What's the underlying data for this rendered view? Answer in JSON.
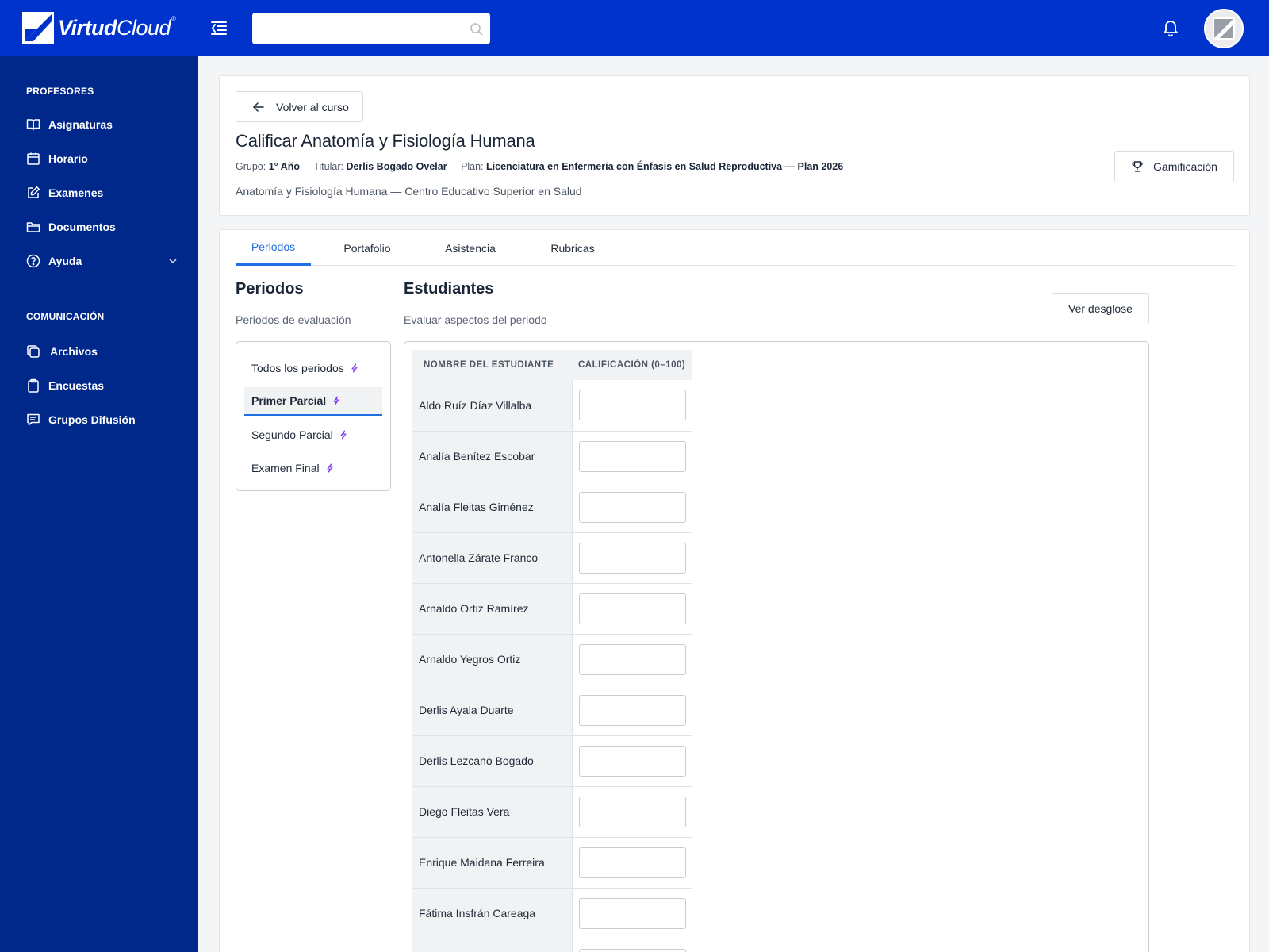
{
  "app": {
    "logo_bold": "Virtud",
    "logo_light": "Cloud",
    "logo_reg": "®"
  },
  "search": {
    "placeholder": "",
    "value": ""
  },
  "sidebar": {
    "sections": [
      {
        "title": "PROFESORES"
      },
      {
        "title": "COMUNICACIÓN"
      }
    ],
    "items": [
      {
        "label": "Asignaturas",
        "icon": "book-icon"
      },
      {
        "label": "Horario",
        "icon": "calendar-icon"
      },
      {
        "label": "Examenes",
        "icon": "edit-icon"
      },
      {
        "label": "Documentos",
        "icon": "folder-icon"
      },
      {
        "label": "Ayuda",
        "icon": "help-icon"
      },
      {
        "label": "Archivos",
        "icon": "copy-icon"
      },
      {
        "label": "Encuestas",
        "icon": "clipboard-icon"
      },
      {
        "label": "Grupos Difusión",
        "icon": "message-icon"
      }
    ]
  },
  "header": {
    "back_label": "Volver al curso",
    "title": "Calificar Anatomía y Fisiología Humana",
    "group_label": "Grupo:",
    "group_value": "1° Año",
    "titular_label": "Titular:",
    "titular_value": "Derlis Bogado Ovelar",
    "plan_label": "Plan:",
    "plan_value": "Licenciatura en Enfermería con Énfasis en Salud Reproductiva — Plan 2026",
    "subtitle": "Anatomía y Fisiología Humana — Centro Educativo Superior en Salud",
    "gamification_label": "Gamificación"
  },
  "tabs": [
    {
      "label": "Periodos",
      "active": true
    },
    {
      "label": "Portafolio",
      "active": false
    },
    {
      "label": "Asistencia",
      "active": false
    },
    {
      "label": "Rubricas",
      "active": false
    }
  ],
  "periods": {
    "title": "Periodos",
    "subtitle": "Periodos de evaluación",
    "items": [
      {
        "label": "Todos los periodos",
        "active": false
      },
      {
        "label": "Primer Parcial",
        "active": true
      },
      {
        "label": "Segundo Parcial",
        "active": false
      },
      {
        "label": "Examen Final",
        "active": false
      }
    ]
  },
  "students": {
    "title": "Estudiantes",
    "subtitle": "Evaluar aspectos del periodo",
    "breakdown_label": "Ver desglose",
    "columns": [
      "Nombre del estudiante",
      "Calificación (0–100)"
    ],
    "rows": [
      {
        "name": "Aldo Ruíz Díaz Villalba",
        "grade": ""
      },
      {
        "name": "Analía Benítez Escobar",
        "grade": ""
      },
      {
        "name": "Analía Fleitas Giménez",
        "grade": ""
      },
      {
        "name": "Antonella Zárate Franco",
        "grade": ""
      },
      {
        "name": "Arnaldo Ortiz Ramírez",
        "grade": ""
      },
      {
        "name": "Arnaldo Yegros Ortiz",
        "grade": ""
      },
      {
        "name": "Derlis Ayala Duarte",
        "grade": ""
      },
      {
        "name": "Derlis Lezcano Bogado",
        "grade": ""
      },
      {
        "name": "Diego Fleitas Vera",
        "grade": ""
      },
      {
        "name": "Enrique Maidana Ferreira",
        "grade": ""
      },
      {
        "name": "Fátima Insfrán Careaga",
        "grade": ""
      },
      {
        "name": "",
        "grade": ""
      }
    ]
  },
  "colors": {
    "topbar": "#0033cc",
    "sidebar": "#00288a",
    "accent": "#1f6fe5",
    "bolt": "#7c3aed"
  }
}
